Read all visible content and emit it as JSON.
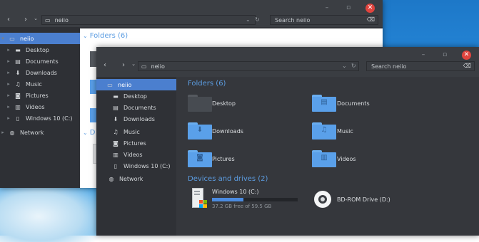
{
  "back_window": {
    "address": "neiio",
    "search_placeholder": "Search neiio",
    "nav": [
      {
        "label": "neiio",
        "icon": "computer-icon"
      },
      {
        "label": "Desktop",
        "icon": "folder-icon"
      },
      {
        "label": "Documents",
        "icon": "documents-icon"
      },
      {
        "label": "Downloads",
        "icon": "download-icon"
      },
      {
        "label": "Music",
        "icon": "music-icon"
      },
      {
        "label": "Pictures",
        "icon": "camera-icon"
      },
      {
        "label": "Videos",
        "icon": "film-icon"
      },
      {
        "label": "Windows 10 (C:)",
        "icon": "drive-icon"
      },
      {
        "label": "Network",
        "icon": "network-icon"
      }
    ],
    "folders_heading": "Folders (6)",
    "devices_heading_partial": "D"
  },
  "front_window": {
    "address": "neiio",
    "search_placeholder": "Search neiio",
    "nav": [
      {
        "label": "neiio",
        "icon": "computer-icon"
      },
      {
        "label": "Desktop",
        "icon": "folder-icon"
      },
      {
        "label": "Documents",
        "icon": "documents-icon"
      },
      {
        "label": "Downloads",
        "icon": "download-icon"
      },
      {
        "label": "Music",
        "icon": "music-icon"
      },
      {
        "label": "Pictures",
        "icon": "camera-icon"
      },
      {
        "label": "Videos",
        "icon": "film-icon"
      },
      {
        "label": "Windows 10 (C:)",
        "icon": "drive-icon"
      },
      {
        "label": "Network",
        "icon": "network-icon"
      }
    ],
    "folders_heading": "Folders (6)",
    "folders": [
      {
        "label": "Desktop",
        "icon": "desktop-folder-icon"
      },
      {
        "label": "Documents",
        "icon": "documents-folder-icon"
      },
      {
        "label": "Downloads",
        "icon": "downloads-folder-icon"
      },
      {
        "label": "Music",
        "icon": "music-folder-icon"
      },
      {
        "label": "Pictures",
        "icon": "pictures-folder-icon"
      },
      {
        "label": "Videos",
        "icon": "videos-folder-icon"
      }
    ],
    "devices_heading": "Devices and drives (2)",
    "drives": [
      {
        "label": "Windows 10 (C:)",
        "free_text": "37.2 GB free of 59.5 GB",
        "used_fraction": 0.37,
        "icon": "windows-drive-icon"
      },
      {
        "label": "BD-ROM Drive (D:)",
        "icon": "optical-disc-icon"
      }
    ]
  },
  "colors": {
    "accent": "#4b7fcf",
    "heading": "#5c9de2",
    "folder": "#5aa0ea",
    "close": "#e0443e",
    "dark_bg": "#35373c",
    "sidebar": "#2e3035"
  }
}
